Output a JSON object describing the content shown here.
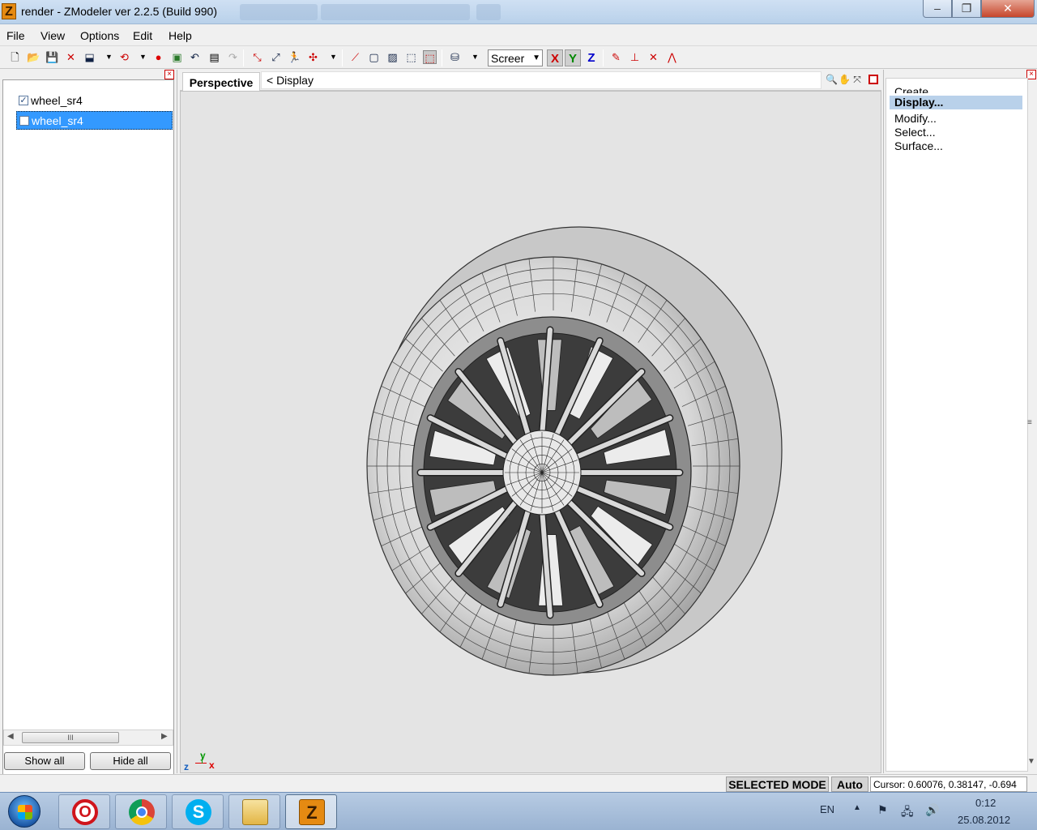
{
  "window": {
    "title": "render - ZModeler ver 2.2.5 (Build 990)",
    "app_icon": "Z",
    "controls": {
      "minimize": "‒",
      "maximize": "❐",
      "close": "✕"
    }
  },
  "menu": [
    "File",
    "View",
    "Options",
    "Edit",
    "Help"
  ],
  "toolbar": {
    "coord_system": "Screer",
    "axes": [
      "X",
      "Y",
      "Z"
    ],
    "axis_colors": {
      "x": "#cc0000",
      "y": "#008800",
      "z": "#0000cc"
    }
  },
  "objects_panel": {
    "items": [
      {
        "label": "wheel_sr4",
        "checked": true,
        "mark": "✓"
      },
      {
        "label": "wheel_sr4",
        "checked": false,
        "mark": ""
      }
    ],
    "scroll_thumb": "III",
    "show_all": "Show all",
    "hide_all": "Hide all"
  },
  "viewport": {
    "tab": "Perspective",
    "breadcrumb": "<  Display",
    "gizmo": {
      "x": "x",
      "y": "y",
      "z": "z"
    }
  },
  "command_panel": {
    "items": [
      "Create",
      "Display...",
      "Modify...",
      "Select...",
      "Surface..."
    ],
    "active": "Display..."
  },
  "status": {
    "mode": "SELECTED MODE",
    "auto": "Auto",
    "cursor": "Cursor: 0.60076, 0.38147, -0.694"
  },
  "taskbar": {
    "apps": [
      "opera",
      "chrome",
      "skype",
      "explorer",
      "zmodeler"
    ],
    "icons": [
      "O",
      "",
      "S",
      "",
      "Z"
    ],
    "language": "EN",
    "time": "0:12",
    "date": "25.08.2012"
  }
}
